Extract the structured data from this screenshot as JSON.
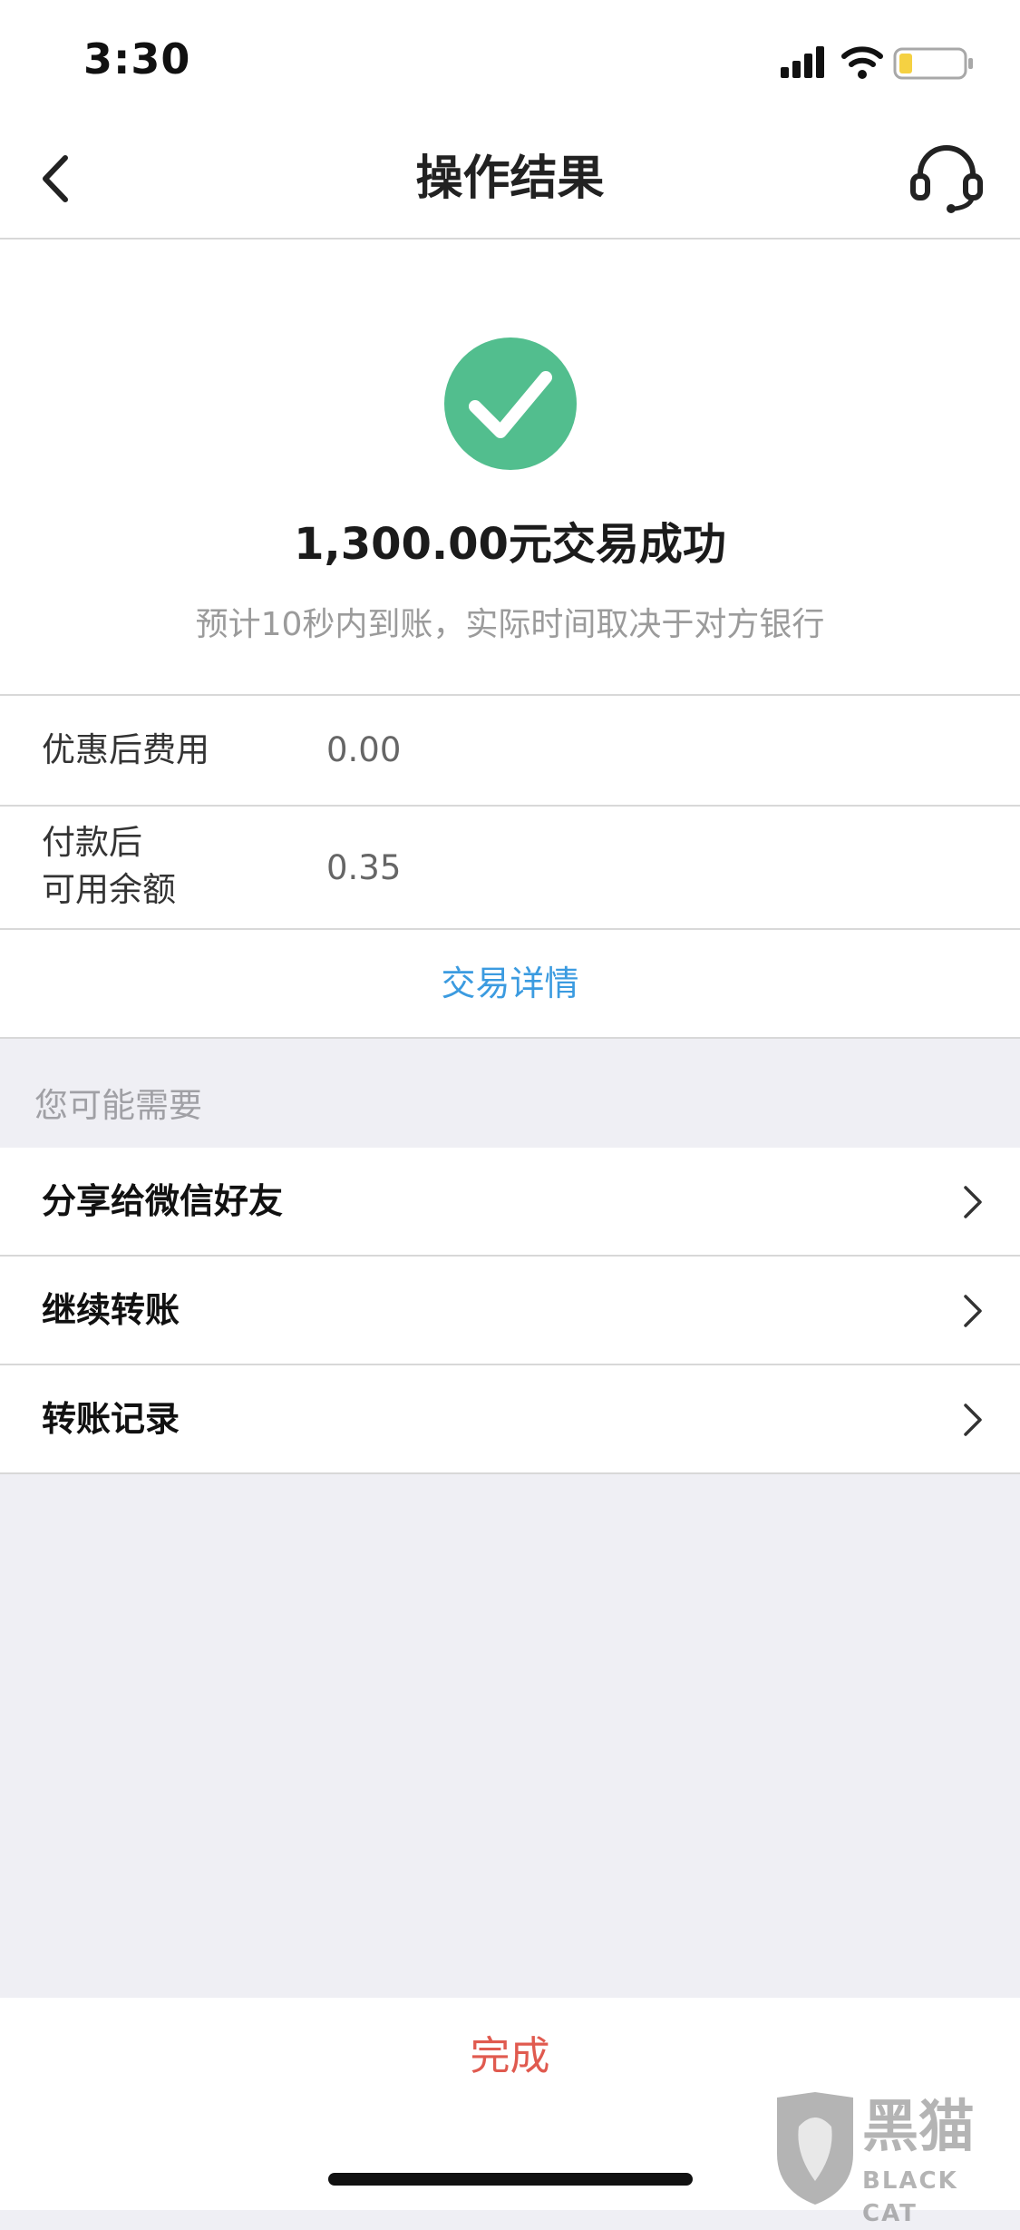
{
  "status_bar": {
    "time": "3:30"
  },
  "nav": {
    "title": "操作结果"
  },
  "result": {
    "title": "1,300.00元交易成功",
    "subtitle": "预计10秒内到账，实际时间取决于对方银行"
  },
  "info_rows": [
    {
      "label_line1": "优惠后费用",
      "value": "0.00"
    },
    {
      "label_line1": "付款后",
      "label_line2": "可用余额",
      "value": "0.35"
    }
  ],
  "detail_link": "交易详情",
  "suggestions": {
    "header": "您可能需要",
    "items": [
      {
        "label": "分享给微信好友"
      },
      {
        "label": "继续转账"
      },
      {
        "label": "转账记录"
      }
    ]
  },
  "done_button": "完成",
  "watermark": {
    "cn": "黑猫",
    "en": "BLACK CAT"
  },
  "colors": {
    "success_green": "#52be8e",
    "link_blue": "#3b9be0",
    "done_red": "#e05a4f",
    "battery_yellow": "#f5d142"
  }
}
